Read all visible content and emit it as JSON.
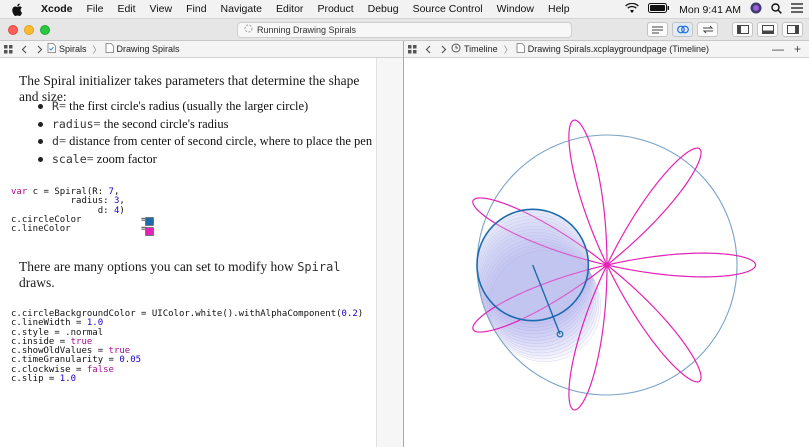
{
  "menubar": {
    "app_name": "Xcode",
    "items": [
      "File",
      "Edit",
      "View",
      "Find",
      "Navigate",
      "Editor",
      "Product",
      "Debug",
      "Source Control",
      "Window",
      "Help"
    ],
    "clock": "Mon 9:41 AM"
  },
  "toolbar": {
    "activity_text": "Running Drawing Spirals"
  },
  "left_jumpbar": {
    "crumb1": "Spirals",
    "crumb2": "Drawing Spirals"
  },
  "right_jumpbar": {
    "crumb1": "Timeline",
    "crumb2": "Drawing Spirals.xcplaygroundpage (Timeline)",
    "minus": "—",
    "plus": "+"
  },
  "content": {
    "intro": "The Spiral initializer takes parameters that determine the shape and size:",
    "bullets": [
      {
        "code": "R",
        "text": " = the first circle's radius (usually the larger circle)"
      },
      {
        "code": "radius",
        "text": " = the second circle's radius"
      },
      {
        "code": "d",
        "text": " = distance from center of second circle, where to place the pen"
      },
      {
        "code": "scale",
        "text": " = zoom factor"
      }
    ],
    "options_prefix": "There are many options you can set to modify how ",
    "options_code": "Spiral",
    "options_suffix": " draws.",
    "code1": {
      "l1_kw": "var",
      "l1_a": " c = Spiral(R: ",
      "l1_n": "7",
      "l1_b": ",",
      "l2_a": "           radius: ",
      "l2_n": "3",
      "l2_b": ",",
      "l3_a": "                d: ",
      "l3_n": "4",
      "l3_b": ")",
      "l4": "c.circleColor           = ",
      "l5": "c.lineColor             = "
    },
    "code2": {
      "l1_a": "c.circleBackgroundColor = UIColor.white().withAlphaComponent(",
      "l1_n": "0.2",
      "l1_b": ")",
      "l2_a": "c.lineWidth = ",
      "l2_n": "1.0",
      "l3": "c.style = .normal",
      "l4_a": "c.inside = ",
      "l4_k": "true",
      "l5_a": "c.showOldValues = ",
      "l5_k": "true",
      "l6_a": "c.timeGranularity = ",
      "l6_n": "0.05",
      "l7_a": "c.clockwise = ",
      "l7_k": "false",
      "l8_a": "c.slip = ",
      "l8_n": "1.0"
    }
  },
  "spiral": {
    "R": 7,
    "radius": 3,
    "d": 4,
    "circle_color": "#1d6aad",
    "line_color": "#e422b6",
    "outer_circle_color": "#7aa3c8"
  },
  "colors": {
    "keyword": "#aa0d91",
    "number": "#1c00cf"
  }
}
